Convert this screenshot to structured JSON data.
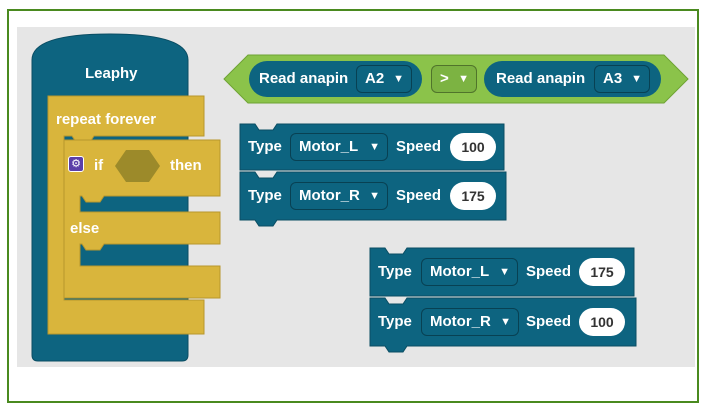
{
  "colors": {
    "frame_border": "#4a8a1f",
    "workspace_bg": "#e6e6e6",
    "leaphy_block": "#0d6480",
    "control_block": "#d9b53c",
    "logic_block": "#8bc34a",
    "motor_block": "#0d6480",
    "mutator_icon": "#5b3fa8"
  },
  "leaphy_block": {
    "label": "Leaphy"
  },
  "repeat_block": {
    "label": "repeat forever"
  },
  "if_block": {
    "if_label": "if",
    "then_label": "then",
    "else_label": "else",
    "mutator_icon": "gear-icon"
  },
  "compare_block": {
    "left": {
      "label": "Read anapin",
      "pin": "A2"
    },
    "operator": ">",
    "right": {
      "label": "Read anapin",
      "pin": "A3"
    }
  },
  "motor_group_1": [
    {
      "type_label": "Type",
      "motor": "Motor_L",
      "speed_label": "Speed",
      "speed": "100"
    },
    {
      "type_label": "Type",
      "motor": "Motor_R",
      "speed_label": "Speed",
      "speed": "175"
    }
  ],
  "motor_group_2": [
    {
      "type_label": "Type",
      "motor": "Motor_L",
      "speed_label": "Speed",
      "speed": "175"
    },
    {
      "type_label": "Type",
      "motor": "Motor_R",
      "speed_label": "Speed",
      "speed": "100"
    }
  ],
  "dropdown_icon": "triangle-down-icon"
}
